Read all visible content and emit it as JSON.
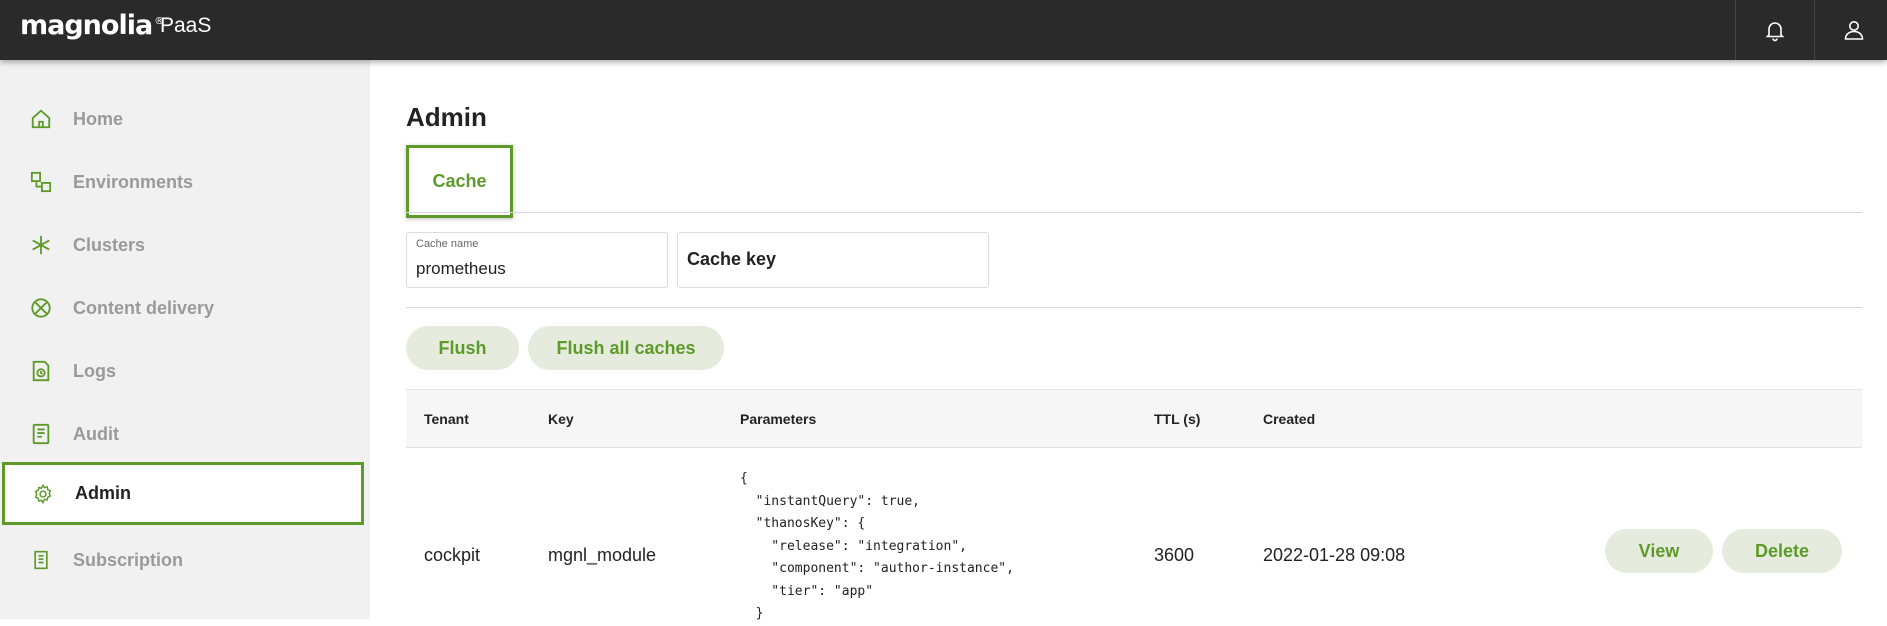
{
  "header": {
    "logo_text": "magnolia",
    "logo_mark": "®",
    "product": "PaaS",
    "notifications_icon": "bell-icon",
    "user_icon": "user-icon"
  },
  "sidebar": {
    "items": [
      {
        "label": "Home",
        "icon": "home-icon"
      },
      {
        "label": "Environments",
        "icon": "environments-icon"
      },
      {
        "label": "Clusters",
        "icon": "clusters-icon"
      },
      {
        "label": "Content delivery",
        "icon": "content-delivery-icon"
      },
      {
        "label": "Logs",
        "icon": "logs-icon"
      },
      {
        "label": "Audit",
        "icon": "audit-icon"
      },
      {
        "label": "Admin",
        "icon": "gear-icon",
        "active": true
      },
      {
        "label": "Subscription",
        "icon": "subscription-icon"
      }
    ]
  },
  "main": {
    "title": "Admin",
    "tabs": [
      {
        "label": "Cache",
        "active": true
      }
    ],
    "form": {
      "cache_name_label": "Cache name",
      "cache_name_value": "prometheus",
      "cache_key_placeholder": "Cache key"
    },
    "actions": {
      "flush": "Flush",
      "flush_all": "Flush all caches"
    },
    "table": {
      "columns": [
        "Tenant",
        "Key",
        "Parameters",
        "TTL (s)",
        "Created"
      ],
      "rows": [
        {
          "tenant": "cockpit",
          "key": "mgnl_module",
          "parameters": "{\n  \"instantQuery\": true,\n  \"thanosKey\": {\n    \"release\": \"integration\",\n    \"component\": \"author-instance\",\n    \"tier\": \"app\"\n  }",
          "ttl": "3600",
          "created": "2022-01-28 09:08",
          "view_label": "View",
          "delete_label": "Delete"
        }
      ]
    }
  },
  "colors": {
    "accent": "#5e9a2a",
    "topbar": "#2a2a2a",
    "sidebar_bg": "#f1f1f1",
    "pill_bg": "#e5ecdd"
  }
}
